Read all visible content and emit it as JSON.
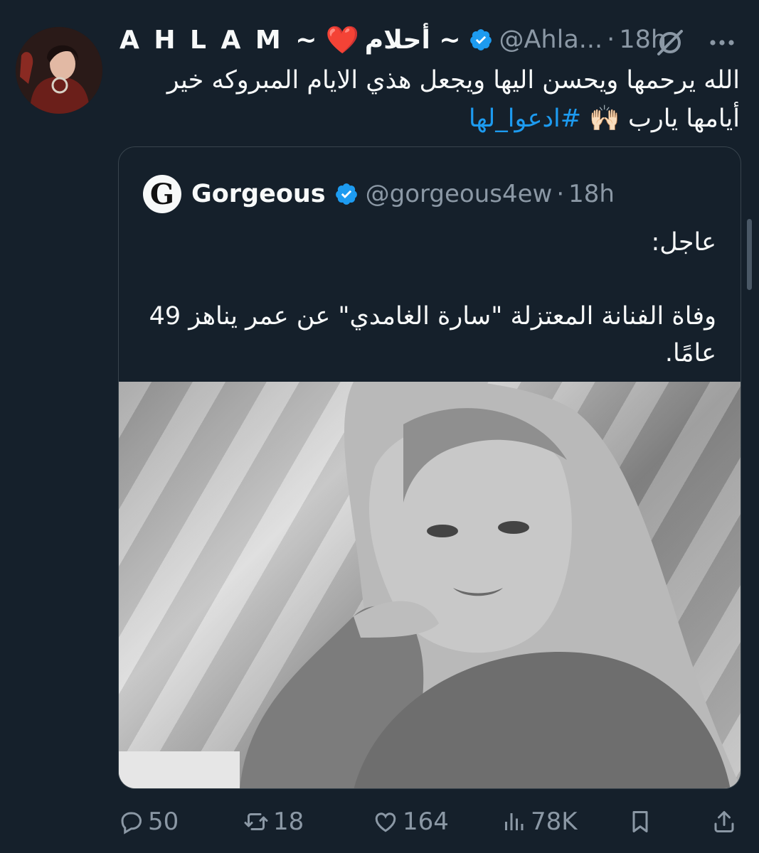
{
  "tweet": {
    "display_name": "A H L A M ~",
    "heart": "❤️",
    "display_name_ar": "~ أحلام",
    "handle": "@Ahla...",
    "separator": "·",
    "time": "18h",
    "text_line1": "الله يرحمها ويحسن اليها ويجعل هذي الايام المبروكه خير",
    "text_line2_prefix": "أيامها يارب 🙌🏻 ",
    "hashtag": "#ادعوا_لها",
    "avatar_icon": "profile-photo"
  },
  "quote": {
    "avatar_letter": "G",
    "name": "Gorgeous",
    "handle": "@gorgeous4ew",
    "separator": "·",
    "time": "18h",
    "text_para1": "عاجل:",
    "text_para2": "وفاة الفنانة المعتزلة \"سارة الغامدي\" عن عمر يناهز 49 عامًا."
  },
  "actions": {
    "replies": "50",
    "retweets": "18",
    "likes": "164",
    "views": "78K"
  },
  "colors": {
    "background": "#15202b",
    "accent": "#1d9bf0",
    "muted": "#8b98a5",
    "heart": "#e0245e"
  }
}
